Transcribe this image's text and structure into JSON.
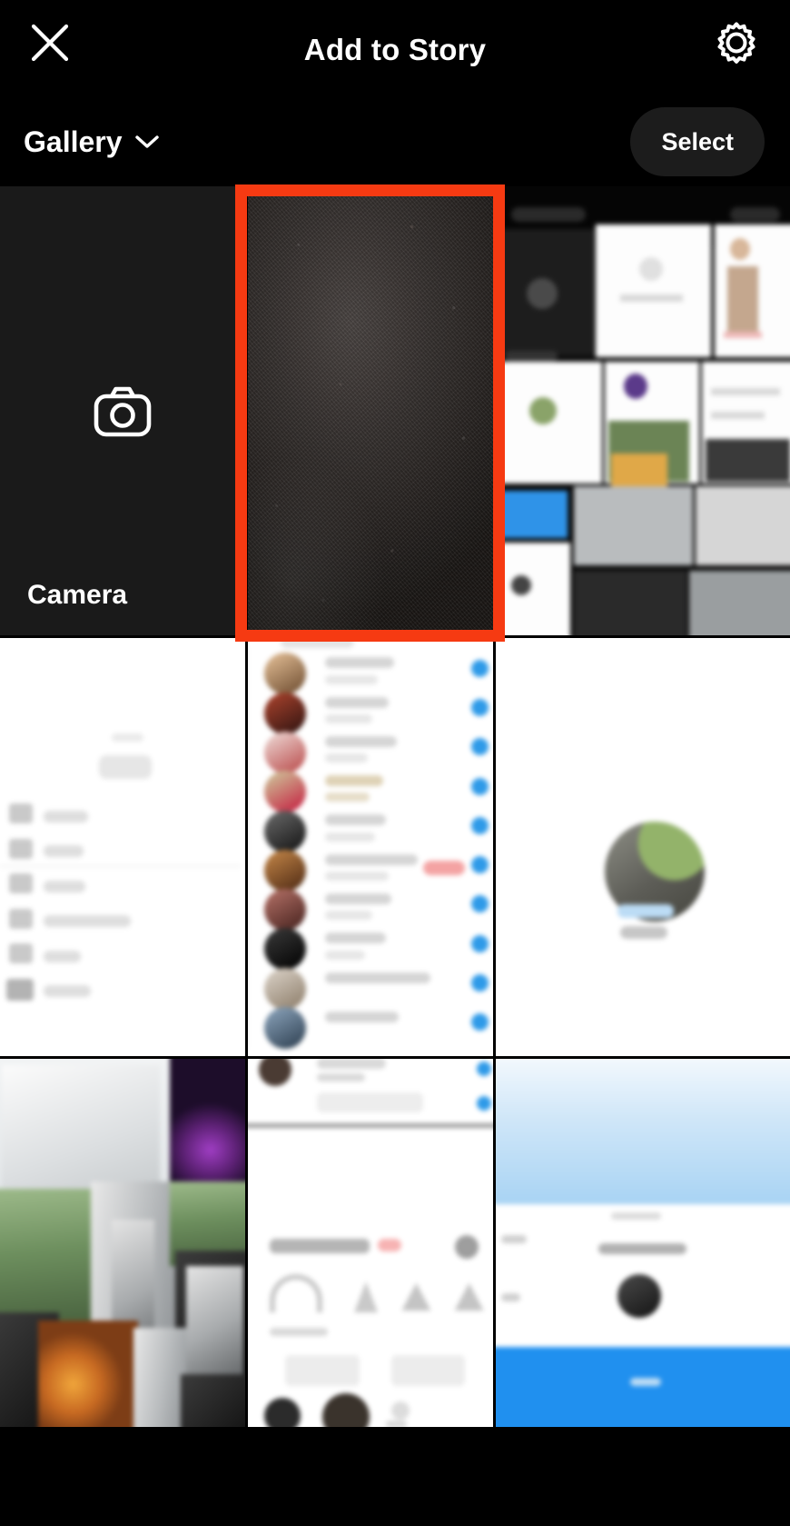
{
  "header": {
    "title": "Add to Story",
    "close_icon": "close-x-icon",
    "settings_icon": "gear-icon"
  },
  "subheader": {
    "source_label": "Gallery",
    "source_chevron_icon": "chevron-down-icon",
    "select_label": "Select"
  },
  "camera_tile": {
    "label": "Camera",
    "icon": "camera-icon"
  },
  "annotation": {
    "color": "#F63A12",
    "target": "gallery-thumb-1"
  },
  "gallery": {
    "thumbs": [
      {
        "id": "gallery-thumb-1",
        "kind": "photo",
        "desc": "dark fabric texture",
        "selected": true
      },
      {
        "id": "gallery-thumb-2",
        "kind": "screenshot",
        "desc": "dark app with white cards",
        "selected": false
      },
      {
        "id": "gallery-thumb-3",
        "kind": "screenshot",
        "desc": "white settings list",
        "selected": false
      },
      {
        "id": "gallery-thumb-4",
        "kind": "screenshot",
        "desc": "contact chat list",
        "selected": false
      },
      {
        "id": "gallery-thumb-5",
        "kind": "screenshot",
        "desc": "profile page",
        "selected": false
      },
      {
        "id": "gallery-thumb-6",
        "kind": "photo",
        "desc": "outdoor photo collage",
        "selected": false
      },
      {
        "id": "gallery-thumb-7",
        "kind": "screenshot",
        "desc": "white share sheet",
        "selected": false
      },
      {
        "id": "gallery-thumb-8",
        "kind": "screenshot",
        "desc": "blue header app",
        "selected": false
      }
    ]
  },
  "colors": {
    "background": "#000000",
    "camera_tile": "#1a1a1a",
    "select_pill": "#1c1c1c",
    "annotation_red": "#F63A12",
    "text": "#ffffff"
  }
}
